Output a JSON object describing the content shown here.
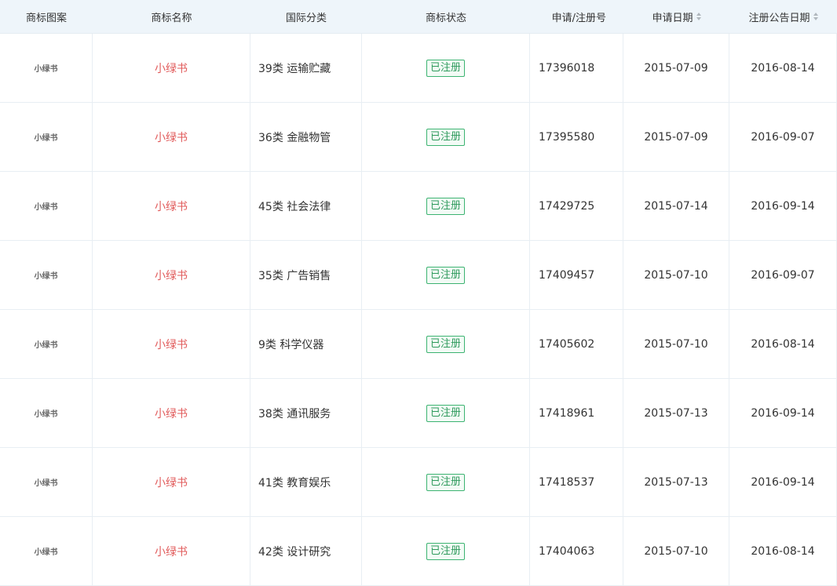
{
  "columns": [
    "商标图案",
    "商标名称",
    "国际分类",
    "商标状态",
    "申请/注册号",
    "申请日期",
    "注册公告日期"
  ],
  "rows": [
    {
      "logo": "小绿书",
      "name": "小绿书",
      "class": "39类 运输贮藏",
      "status": "已注册",
      "reg_no": "17396018",
      "apply_date": "2015-07-09",
      "pub_date": "2016-08-14"
    },
    {
      "logo": "小绿书",
      "name": "小绿书",
      "class": "36类 金融物管",
      "status": "已注册",
      "reg_no": "17395580",
      "apply_date": "2015-07-09",
      "pub_date": "2016-09-07"
    },
    {
      "logo": "小绿书",
      "name": "小绿书",
      "class": "45类 社会法律",
      "status": "已注册",
      "reg_no": "17429725",
      "apply_date": "2015-07-14",
      "pub_date": "2016-09-14"
    },
    {
      "logo": "小绿书",
      "name": "小绿书",
      "class": "35类 广告销售",
      "status": "已注册",
      "reg_no": "17409457",
      "apply_date": "2015-07-10",
      "pub_date": "2016-09-07"
    },
    {
      "logo": "小绿书",
      "name": "小绿书",
      "class": "9类 科学仪器",
      "status": "已注册",
      "reg_no": "17405602",
      "apply_date": "2015-07-10",
      "pub_date": "2016-08-14"
    },
    {
      "logo": "小绿书",
      "name": "小绿书",
      "class": "38类 通讯服务",
      "status": "已注册",
      "reg_no": "17418961",
      "apply_date": "2015-07-13",
      "pub_date": "2016-09-14"
    },
    {
      "logo": "小绿书",
      "name": "小绿书",
      "class": "41类 教育娱乐",
      "status": "已注册",
      "reg_no": "17418537",
      "apply_date": "2015-07-13",
      "pub_date": "2016-09-14"
    },
    {
      "logo": "小绿书",
      "name": "小绿书",
      "class": "42类 设计研究",
      "status": "已注册",
      "reg_no": "17404063",
      "apply_date": "2015-07-10",
      "pub_date": "2016-08-14"
    }
  ],
  "colors": {
    "name_red": "#e15b5b",
    "status_green": "#2e9a5c",
    "header_bg": "#eef5fa"
  },
  "icons": {
    "sort": "sort-caret-icon"
  }
}
